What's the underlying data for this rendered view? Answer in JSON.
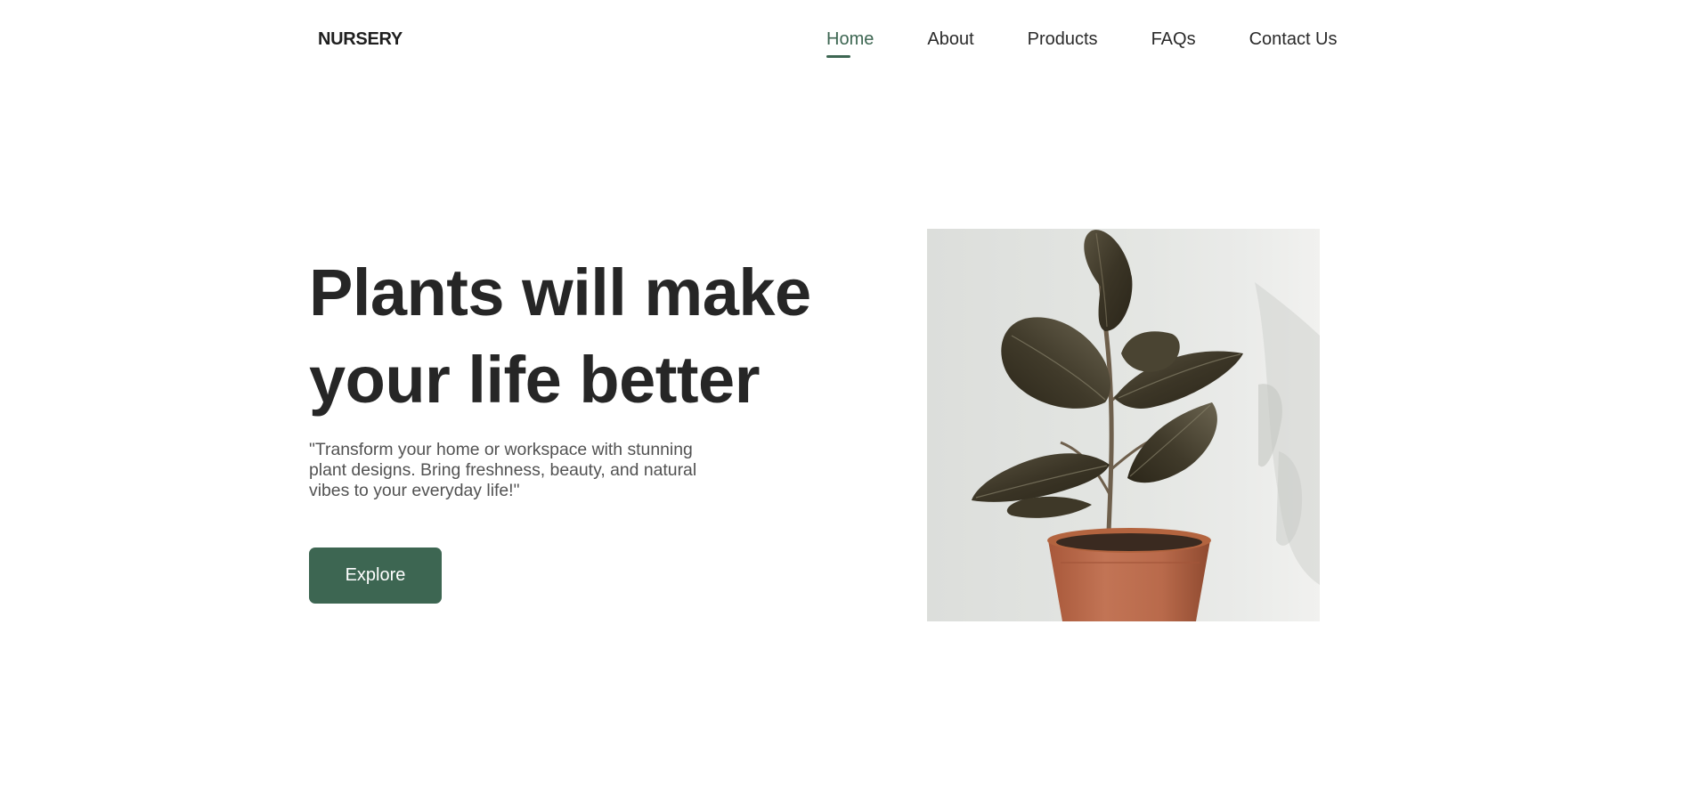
{
  "header": {
    "logo": "NURSERY",
    "nav": [
      {
        "label": "Home",
        "active": true
      },
      {
        "label": "About",
        "active": false
      },
      {
        "label": "Products",
        "active": false
      },
      {
        "label": "FAQs",
        "active": false
      },
      {
        "label": "Contact Us",
        "active": false
      }
    ]
  },
  "hero": {
    "title_line1": "Plants will make",
    "title_line2": "your life better",
    "description": "\"Transform your home or workspace with stunning plant designs. Bring freshness, beauty, and natural vibes to your everyday life!\"",
    "button_label": "Explore"
  },
  "colors": {
    "accent": "#3d6652",
    "heading": "#262626",
    "body_text": "#525252",
    "nav_text": "#2a2a2a",
    "background": "#ffffff"
  }
}
